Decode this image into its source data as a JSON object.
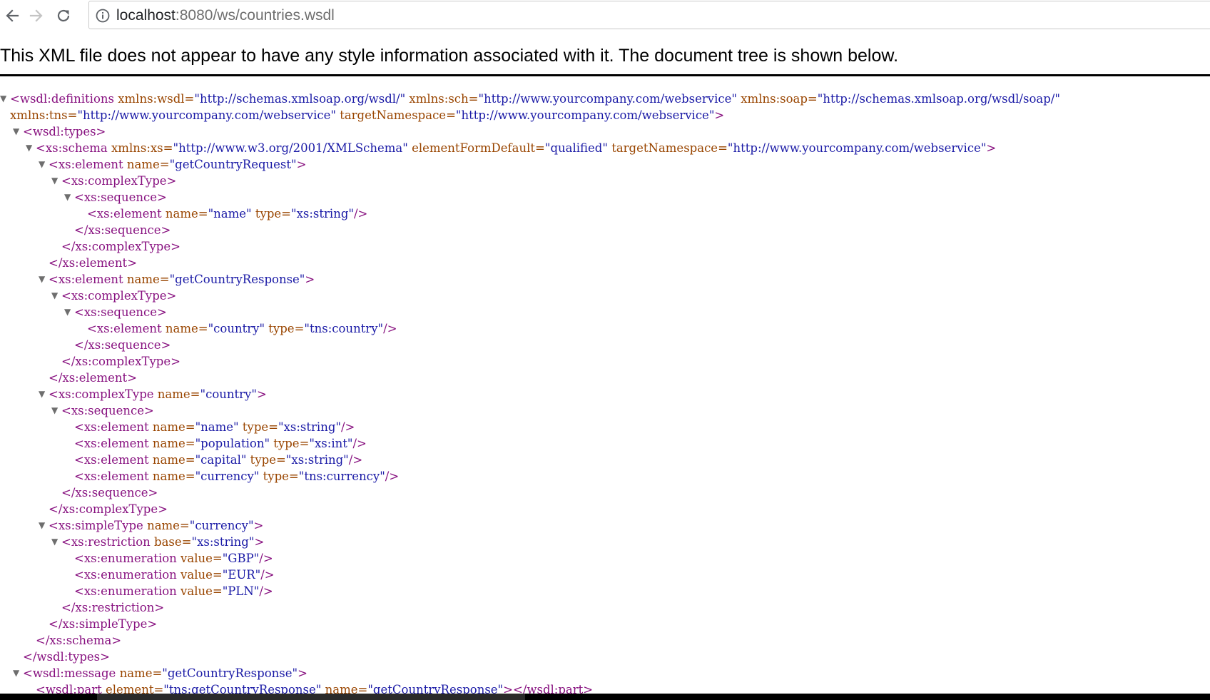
{
  "browser": {
    "back_icon": "arrow-left-icon",
    "forward_icon": "arrow-right-icon",
    "reload_icon": "reload-icon",
    "info_icon": "info-circle-icon",
    "url_host": "localhost",
    "url_rest": ":8080/ws/countries.wsdl"
  },
  "banner": {
    "text": "This XML file does not appear to have any style information associated with it. The document tree is shown below."
  },
  "tree_lines": [
    {
      "twisty": "▼",
      "tokens": [
        [
          "t",
          "<wsdl:definitions "
        ],
        [
          "n",
          "xmlns:wsdl="
        ],
        [
          "v",
          "\"http://schemas.xmlsoap.org/wsdl/\""
        ],
        [
          "n",
          " xmlns:sch="
        ],
        [
          "v",
          "\"http://www.yourcompany.com/webservice\""
        ],
        [
          "n",
          " xmlns:soap="
        ],
        [
          "v",
          "\"http://schemas.xmlsoap.org/wsdl/soap/\""
        ]
      ]
    },
    {
      "twisty": "",
      "tokens": [
        [
          "n",
          "xmlns:tns="
        ],
        [
          "v",
          "\"http://www.yourcompany.com/webservice\""
        ],
        [
          "n",
          " targetNamespace="
        ],
        [
          "v",
          "\"http://www.yourcompany.com/webservice\""
        ],
        [
          "t",
          ">"
        ]
      ]
    },
    {
      "twisty": "▼",
      "tokens": [
        [
          "t",
          "<wsdl:types>"
        ]
      ]
    },
    {
      "twisty": "▼",
      "tokens": [
        [
          "t",
          "<xs:schema "
        ],
        [
          "n",
          "xmlns:xs="
        ],
        [
          "v",
          "\"http://www.w3.org/2001/XMLSchema\""
        ],
        [
          "n",
          " elementFormDefault="
        ],
        [
          "v",
          "\"qualified\""
        ],
        [
          "n",
          " targetNamespace="
        ],
        [
          "v",
          "\"http://www.yourcompany.com/webservice\""
        ],
        [
          "t",
          ">"
        ]
      ]
    },
    {
      "twisty": "▼",
      "tokens": [
        [
          "t",
          "<xs:element "
        ],
        [
          "n",
          "name="
        ],
        [
          "v",
          "\"getCountryRequest\""
        ],
        [
          "t",
          ">"
        ]
      ]
    },
    {
      "twisty": "▼",
      "tokens": [
        [
          "t",
          "<xs:complexType>"
        ]
      ]
    },
    {
      "twisty": "▼",
      "tokens": [
        [
          "t",
          "<xs:sequence>"
        ]
      ]
    },
    {
      "twisty": "",
      "tokens": [
        [
          "t",
          "<xs:element "
        ],
        [
          "n",
          "name="
        ],
        [
          "v",
          "\"name\""
        ],
        [
          "n",
          " type="
        ],
        [
          "v",
          "\"xs:string\""
        ],
        [
          "t",
          "/>"
        ]
      ]
    },
    {
      "twisty": "",
      "tokens": [
        [
          "t",
          "</xs:sequence>"
        ]
      ]
    },
    {
      "twisty": "",
      "tokens": [
        [
          "t",
          "</xs:complexType>"
        ]
      ]
    },
    {
      "twisty": "",
      "tokens": [
        [
          "t",
          "</xs:element>"
        ]
      ]
    },
    {
      "twisty": "▼",
      "tokens": [
        [
          "t",
          "<xs:element "
        ],
        [
          "n",
          "name="
        ],
        [
          "v",
          "\"getCountryResponse\""
        ],
        [
          "t",
          ">"
        ]
      ]
    },
    {
      "twisty": "▼",
      "tokens": [
        [
          "t",
          "<xs:complexType>"
        ]
      ]
    },
    {
      "twisty": "▼",
      "tokens": [
        [
          "t",
          "<xs:sequence>"
        ]
      ]
    },
    {
      "twisty": "",
      "tokens": [
        [
          "t",
          "<xs:element "
        ],
        [
          "n",
          "name="
        ],
        [
          "v",
          "\"country\""
        ],
        [
          "n",
          " type="
        ],
        [
          "v",
          "\"tns:country\""
        ],
        [
          "t",
          "/>"
        ]
      ]
    },
    {
      "twisty": "",
      "tokens": [
        [
          "t",
          "</xs:sequence>"
        ]
      ]
    },
    {
      "twisty": "",
      "tokens": [
        [
          "t",
          "</xs:complexType>"
        ]
      ]
    },
    {
      "twisty": "",
      "tokens": [
        [
          "t",
          "</xs:element>"
        ]
      ]
    },
    {
      "twisty": "▼",
      "tokens": [
        [
          "t",
          "<xs:complexType "
        ],
        [
          "n",
          "name="
        ],
        [
          "v",
          "\"country\""
        ],
        [
          "t",
          ">"
        ]
      ]
    },
    {
      "twisty": "▼",
      "tokens": [
        [
          "t",
          "<xs:sequence>"
        ]
      ]
    },
    {
      "twisty": "",
      "tokens": [
        [
          "t",
          "<xs:element "
        ],
        [
          "n",
          "name="
        ],
        [
          "v",
          "\"name\""
        ],
        [
          "n",
          " type="
        ],
        [
          "v",
          "\"xs:string\""
        ],
        [
          "t",
          "/>"
        ]
      ]
    },
    {
      "twisty": "",
      "tokens": [
        [
          "t",
          "<xs:element "
        ],
        [
          "n",
          "name="
        ],
        [
          "v",
          "\"population\""
        ],
        [
          "n",
          " type="
        ],
        [
          "v",
          "\"xs:int\""
        ],
        [
          "t",
          "/>"
        ]
      ]
    },
    {
      "twisty": "",
      "tokens": [
        [
          "t",
          "<xs:element "
        ],
        [
          "n",
          "name="
        ],
        [
          "v",
          "\"capital\""
        ],
        [
          "n",
          " type="
        ],
        [
          "v",
          "\"xs:string\""
        ],
        [
          "t",
          "/>"
        ]
      ]
    },
    {
      "twisty": "",
      "tokens": [
        [
          "t",
          "<xs:element "
        ],
        [
          "n",
          "name="
        ],
        [
          "v",
          "\"currency\""
        ],
        [
          "n",
          " type="
        ],
        [
          "v",
          "\"tns:currency\""
        ],
        [
          "t",
          "/>"
        ]
      ]
    },
    {
      "twisty": "",
      "tokens": [
        [
          "t",
          "</xs:sequence>"
        ]
      ]
    },
    {
      "twisty": "",
      "tokens": [
        [
          "t",
          "</xs:complexType>"
        ]
      ]
    },
    {
      "twisty": "▼",
      "tokens": [
        [
          "t",
          "<xs:simpleType "
        ],
        [
          "n",
          "name="
        ],
        [
          "v",
          "\"currency\""
        ],
        [
          "t",
          ">"
        ]
      ]
    },
    {
      "twisty": "▼",
      "tokens": [
        [
          "t",
          "<xs:restriction "
        ],
        [
          "n",
          "base="
        ],
        [
          "v",
          "\"xs:string\""
        ],
        [
          "t",
          ">"
        ]
      ]
    },
    {
      "twisty": "",
      "tokens": [
        [
          "t",
          "<xs:enumeration "
        ],
        [
          "n",
          "value="
        ],
        [
          "v",
          "\"GBP\""
        ],
        [
          "t",
          "/>"
        ]
      ]
    },
    {
      "twisty": "",
      "tokens": [
        [
          "t",
          "<xs:enumeration "
        ],
        [
          "n",
          "value="
        ],
        [
          "v",
          "\"EUR\""
        ],
        [
          "t",
          "/>"
        ]
      ]
    },
    {
      "twisty": "",
      "tokens": [
        [
          "t",
          "<xs:enumeration "
        ],
        [
          "n",
          "value="
        ],
        [
          "v",
          "\"PLN\""
        ],
        [
          "t",
          "/>"
        ]
      ]
    },
    {
      "twisty": "",
      "tokens": [
        [
          "t",
          "</xs:restriction>"
        ]
      ]
    },
    {
      "twisty": "",
      "tokens": [
        [
          "t",
          "</xs:simpleType>"
        ]
      ]
    },
    {
      "twisty": "",
      "tokens": [
        [
          "t",
          "</xs:schema>"
        ]
      ]
    },
    {
      "twisty": "",
      "tokens": [
        [
          "t",
          "</wsdl:types>"
        ]
      ]
    },
    {
      "twisty": "▼",
      "tokens": [
        [
          "t",
          "<wsdl:message "
        ],
        [
          "n",
          "name="
        ],
        [
          "v",
          "\"getCountryResponse\""
        ],
        [
          "t",
          ">"
        ]
      ]
    },
    {
      "twisty": "",
      "tokens": [
        [
          "t",
          "<wsdl:part "
        ],
        [
          "n",
          "element="
        ],
        [
          "v",
          "\"tns:getCountryResponse\""
        ],
        [
          "n",
          " name="
        ],
        [
          "v",
          "\"getCountryResponse\""
        ],
        [
          "t",
          "></wsdl:part>"
        ]
      ]
    }
  ]
}
